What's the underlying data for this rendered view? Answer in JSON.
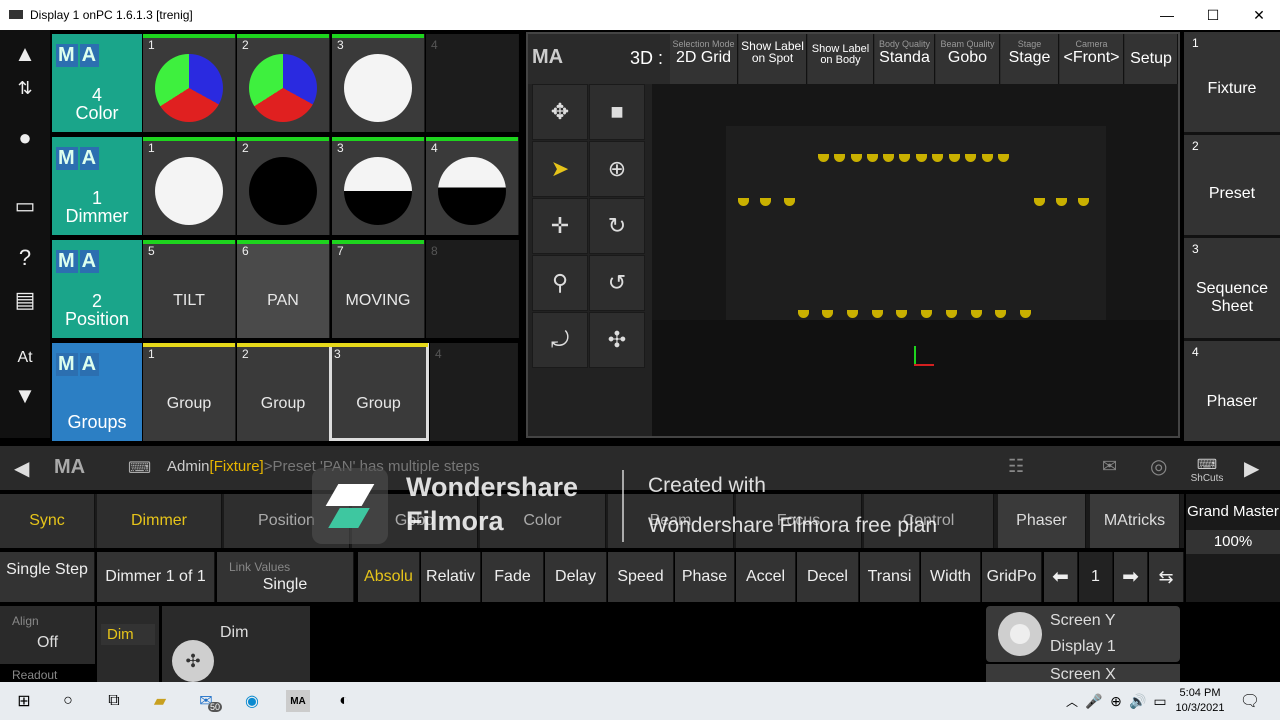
{
  "window": {
    "title": "Display 1 onPC 1.6.1.3 [trenig]",
    "minimize": "—",
    "maximize": "☐",
    "close": "✕"
  },
  "left_bar": [
    "▲",
    "⇅",
    "●",
    "▭",
    "?",
    "▤",
    "At",
    "▼"
  ],
  "pools": [
    {
      "title_num": "4",
      "title_label": "Color",
      "badge": "G",
      "cells": [
        {
          "num": "1"
        },
        {
          "num": "2"
        },
        {
          "num": "3"
        },
        {
          "num": "4"
        }
      ]
    },
    {
      "title_num": "1",
      "title_label": "Dimmer",
      "badge": "U",
      "cells": [
        {
          "num": "1"
        },
        {
          "num": "2"
        },
        {
          "num": "3"
        },
        {
          "num": "4"
        }
      ]
    },
    {
      "title_num": "2",
      "title_label": "Position",
      "badge": "S",
      "cells": [
        {
          "num": "5",
          "label": "TILT"
        },
        {
          "num": "6",
          "label": "PAN"
        },
        {
          "num": "7",
          "label": "MOVING"
        },
        {
          "num": "8",
          "label": ""
        }
      ]
    },
    {
      "title_num": "",
      "title_label": "Groups",
      "badge": "",
      "cells": [
        {
          "num": "1",
          "label": "Group"
        },
        {
          "num": "2",
          "label": "Group"
        },
        {
          "num": "3",
          "label": "Group"
        },
        {
          "num": "4",
          "label": ""
        }
      ]
    }
  ],
  "viewer": {
    "ma": "MA",
    "mode": "3D :",
    "buttons": [
      {
        "small": "Selection Mode",
        "value": "2D Grid"
      },
      {
        "small": "",
        "value": "Show Label on Spot"
      },
      {
        "small": "",
        "value": "Show Label on Body"
      },
      {
        "small": "Body Quality",
        "value": "Standa"
      },
      {
        "small": "Beam Quality",
        "value": "Gobo"
      },
      {
        "small": "Stage",
        "value": "Stage"
      },
      {
        "small": "Camera",
        "value": "<Front>"
      },
      {
        "small": "",
        "value": "Setup"
      }
    ]
  },
  "right_bar": [
    {
      "num": "1",
      "label": "Fixture"
    },
    {
      "num": "2",
      "label": "Preset"
    },
    {
      "num": "3",
      "label": "Sequence Sheet"
    },
    {
      "num": "4",
      "label": "Phaser"
    }
  ],
  "command_line": {
    "prefix": "Admin",
    "context": "[Fixture]",
    "rest": ">Preset 'PAN' has multiple steps",
    "shortcuts": "ShCuts"
  },
  "preset_types": [
    "Sync",
    "Dimmer",
    "Position",
    "Gobo",
    "Color",
    "Beam",
    "Focus",
    "Control",
    "Phaser",
    "MAtricks"
  ],
  "grand_master": {
    "label": "Grand Master",
    "value": "100%"
  },
  "row2": {
    "single_step": "Single Step",
    "dimmer_of": "Dimmer 1 of 1",
    "link_values_label": "Link Values",
    "link_values": "Single",
    "features": [
      "Absolu",
      "Relativ",
      "Fade",
      "Delay",
      "Speed",
      "Phase",
      "Accel",
      "Decel",
      "Transi",
      "Width",
      "GridPo"
    ],
    "page": "1"
  },
  "row3": {
    "align_label": "Align",
    "align_value": "Off",
    "dim_attr": "Dim",
    "dim_enc": "Dim",
    "readout": "Readout",
    "screen_y": "Screen Y",
    "display": "Display 1",
    "screen_x": "Screen X"
  },
  "watermark": {
    "brand1": "Wondershare",
    "brand2": "Filmora",
    "created": "Created with",
    "plan": "Wondershare Filmora free plan"
  },
  "taskbar": {
    "time": "5:04 PM",
    "date": "10/3/2021",
    "badge": "50"
  },
  "colors": {
    "accent": "#1aa58a",
    "yellow": "#e6c41a",
    "green": "#1ed41e"
  }
}
